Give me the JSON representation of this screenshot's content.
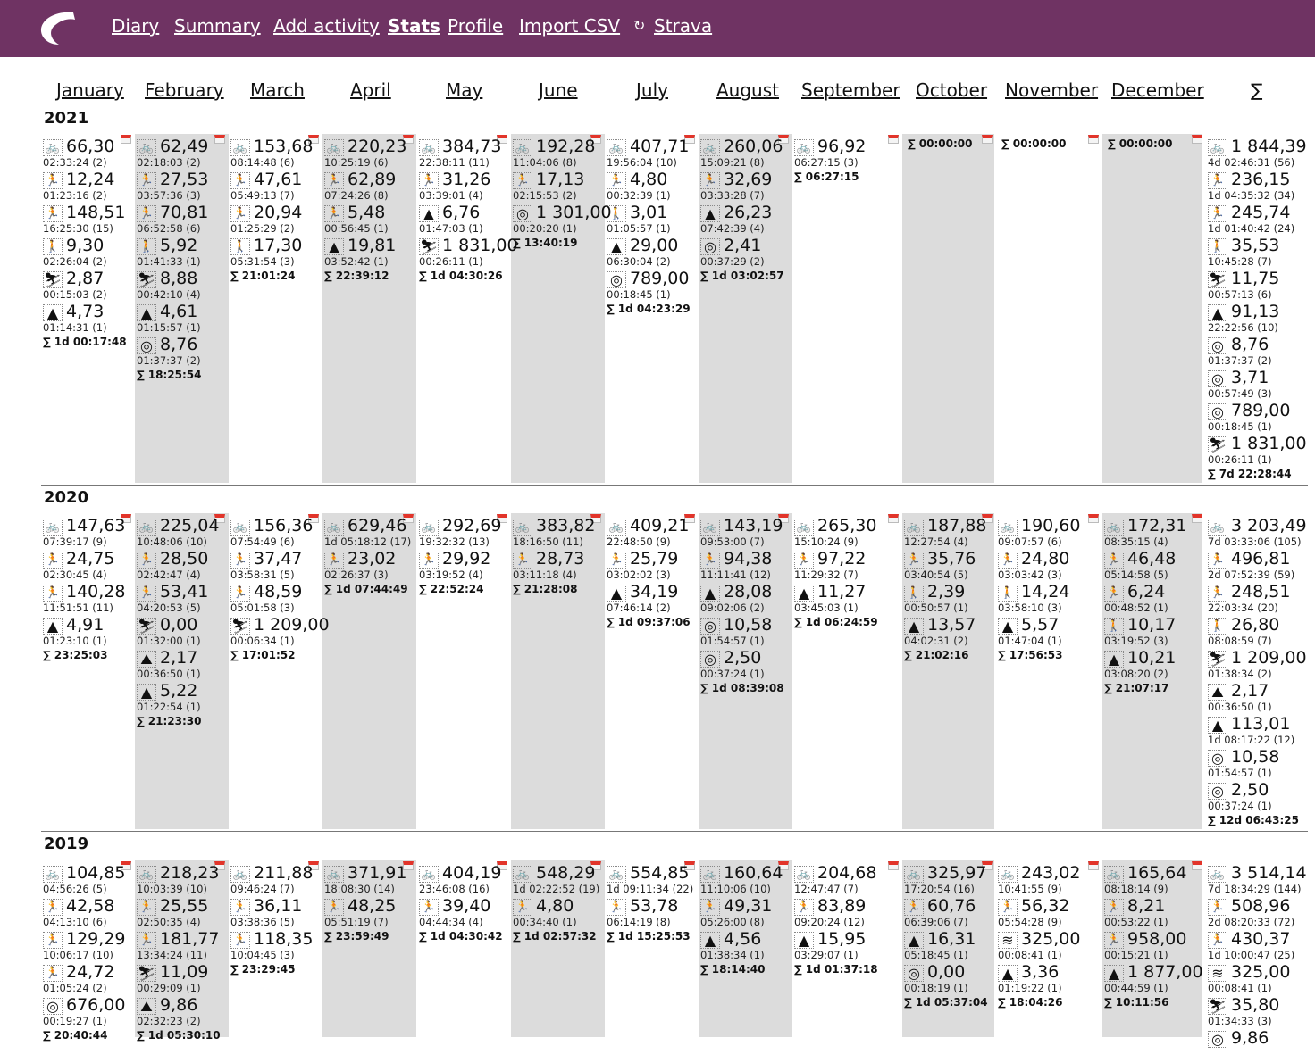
{
  "nav": {
    "items": [
      "Diary",
      "Summary",
      "Add activity",
      "Stats",
      "Profile",
      "Import CSV",
      "Strava"
    ],
    "active": "Stats"
  },
  "months": [
    "January",
    "February",
    "March",
    "April",
    "May",
    "June",
    "July",
    "August",
    "September",
    "October",
    "November",
    "December"
  ],
  "sigma": "∑",
  "icons": {
    "bike": "bicycle-icon",
    "run": "running-icon",
    "trail": "trail-running-icon",
    "walk": "walking-icon",
    "ski": "skiing-icon",
    "hike": "mountain-icon",
    "other": "workout-icon",
    "swim": "swimming-icon",
    "climb": "climbing-icon",
    "sync": "sync-icon"
  },
  "years": [
    {
      "year": "2021",
      "cols": [
        [
          [
            "bike",
            "66,30",
            "02:33:24 (2)"
          ],
          [
            "run",
            "12,24",
            "01:23:16 (2)"
          ],
          [
            "trail",
            "148,51",
            "16:25:30 (15)"
          ],
          [
            "walk",
            "9,30",
            "02:26:04 (2)"
          ],
          [
            "ski",
            "2,87",
            "00:15:03 (2)"
          ],
          [
            "hike",
            "4,73",
            "01:14:31 (1)"
          ],
          "∑ 1d 00:17:48"
        ],
        [
          [
            "bike",
            "62,49",
            "02:18:03 (2)"
          ],
          [
            "run",
            "27,53",
            "03:57:36 (3)"
          ],
          [
            "trail",
            "70,81",
            "06:52:58 (6)"
          ],
          [
            "walk",
            "5,92",
            "01:41:33 (1)"
          ],
          [
            "ski",
            "8,88",
            "00:42:10 (4)"
          ],
          [
            "hike",
            "4,61",
            "01:15:57 (1)"
          ],
          [
            "other",
            "8,76",
            "01:37:37 (2)"
          ],
          "∑ 18:25:54"
        ],
        [
          [
            "bike",
            "153,68",
            "08:14:48 (6)"
          ],
          [
            "run",
            "47,61",
            "05:49:13 (7)"
          ],
          [
            "trail",
            "20,94",
            "01:25:29 (2)"
          ],
          [
            "walk",
            "17,30",
            "05:31:54 (3)"
          ],
          "∑ 21:01:24"
        ],
        [
          [
            "bike",
            "220,23",
            "10:25:19 (6)"
          ],
          [
            "run",
            "62,89",
            "07:24:26 (8)"
          ],
          [
            "trail",
            "5,48",
            "00:56:45 (1)"
          ],
          [
            "hike",
            "19,81",
            "03:52:42 (1)"
          ],
          "∑ 22:39:12"
        ],
        [
          [
            "bike",
            "384,73",
            "22:38:11 (11)"
          ],
          [
            "run",
            "31,26",
            "03:39:01 (4)"
          ],
          [
            "hike",
            "6,76",
            "01:47:03 (1)"
          ],
          [
            "ski",
            "1 831,00",
            "00:26:11 (1)"
          ],
          "∑ 1d 04:30:26"
        ],
        [
          [
            "bike",
            "192,28",
            "11:04:06 (8)"
          ],
          [
            "run",
            "17,13",
            "02:15:53 (2)"
          ],
          [
            "other",
            "1 301,00",
            "00:20:20 (1)"
          ],
          "∑ 13:40:19"
        ],
        [
          [
            "bike",
            "407,71",
            "19:56:04 (10)"
          ],
          [
            "run",
            "4,80",
            "00:32:39 (1)"
          ],
          [
            "walk",
            "3,01",
            "01:05:57 (1)"
          ],
          [
            "hike",
            "29,00",
            "06:30:04 (2)"
          ],
          [
            "other",
            "789,00",
            "00:18:45 (1)"
          ],
          "∑ 1d 04:23:29"
        ],
        [
          [
            "bike",
            "260,06",
            "15:09:21 (8)"
          ],
          [
            "run",
            "32,69",
            "03:33:28 (7)"
          ],
          [
            "hike",
            "26,23",
            "07:42:39 (4)"
          ],
          [
            "other",
            "2,41",
            "00:37:29 (2)"
          ],
          "∑ 1d 03:02:57"
        ],
        [
          [
            "bike",
            "96,92",
            "06:27:15 (3)"
          ],
          "∑ 06:27:15"
        ],
        [
          "∑ 00:00:00"
        ],
        [
          "∑ 00:00:00"
        ],
        [
          "∑ 00:00:00"
        ],
        [
          [
            "bike",
            "1 844,39",
            "4d 02:46:31 (56)"
          ],
          [
            "run",
            "236,15",
            "1d 04:35:32 (34)"
          ],
          [
            "trail",
            "245,74",
            "1d 01:40:42 (24)"
          ],
          [
            "walk",
            "35,53",
            "10:45:28 (7)"
          ],
          [
            "ski",
            "11,75",
            "00:57:13 (6)"
          ],
          [
            "hike",
            "91,13",
            "22:22:56 (10)"
          ],
          [
            "other",
            "8,76",
            "01:37:37 (2)"
          ],
          [
            "other",
            "3,71",
            "00:57:49 (3)"
          ],
          [
            "other",
            "789,00",
            "00:18:45 (1)"
          ],
          [
            "ski",
            "1 831,00",
            "00:26:11 (1)"
          ],
          "∑ 7d 22:28:44"
        ]
      ]
    },
    {
      "year": "2020",
      "cols": [
        [
          [
            "bike",
            "147,63",
            "07:39:17 (9)"
          ],
          [
            "run",
            "24,75",
            "02:30:45 (4)"
          ],
          [
            "trail",
            "140,28",
            "11:51:51 (11)"
          ],
          [
            "hike",
            "4,91",
            "01:23:10 (1)"
          ],
          "∑ 23:25:03"
        ],
        [
          [
            "bike",
            "225,04",
            "10:48:06 (10)"
          ],
          [
            "run",
            "28,50",
            "02:42:47 (4)"
          ],
          [
            "trail",
            "53,41",
            "04:20:53 (5)"
          ],
          [
            "ski",
            "0,00",
            "01:32:00 (1)"
          ],
          [
            "climb",
            "2,17",
            "00:36:50 (1)"
          ],
          [
            "hike",
            "5,22",
            "01:22:54 (1)"
          ],
          "∑ 21:23:30"
        ],
        [
          [
            "bike",
            "156,36",
            "07:54:49 (6)"
          ],
          [
            "run",
            "37,47",
            "03:58:31 (5)"
          ],
          [
            "trail",
            "48,59",
            "05:01:58 (3)"
          ],
          [
            "ski",
            "1 209,00",
            "00:06:34 (1)"
          ],
          "∑ 17:01:52"
        ],
        [
          [
            "bike",
            "629,46",
            "1d 05:18:12 (17)"
          ],
          [
            "run",
            "23,02",
            "02:26:37 (3)"
          ],
          "∑ 1d 07:44:49"
        ],
        [
          [
            "bike",
            "292,69",
            "19:32:32 (13)"
          ],
          [
            "run",
            "29,92",
            "03:19:52 (4)"
          ],
          "∑ 22:52:24"
        ],
        [
          [
            "bike",
            "383,82",
            "18:16:50 (11)"
          ],
          [
            "run",
            "28,73",
            "03:11:18 (4)"
          ],
          "∑ 21:28:08"
        ],
        [
          [
            "bike",
            "409,21",
            "22:48:50 (9)"
          ],
          [
            "run",
            "25,79",
            "03:02:02 (3)"
          ],
          [
            "hike",
            "34,19",
            "07:46:14 (2)"
          ],
          "∑ 1d 09:37:06"
        ],
        [
          [
            "bike",
            "143,19",
            "09:53:00 (7)"
          ],
          [
            "run",
            "94,38",
            "11:11:41 (12)"
          ],
          [
            "hike",
            "28,08",
            "09:02:06 (2)"
          ],
          [
            "other",
            "10,58",
            "01:54:57 (1)"
          ],
          [
            "other",
            "2,50",
            "00:37:24 (1)"
          ],
          "∑ 1d 08:39:08"
        ],
        [
          [
            "bike",
            "265,30",
            "15:10:24 (9)"
          ],
          [
            "run",
            "97,22",
            "11:29:32 (7)"
          ],
          [
            "hike",
            "11,27",
            "03:45:03 (1)"
          ],
          "∑ 1d 06:24:59"
        ],
        [
          [
            "bike",
            "187,88",
            "12:27:54 (4)"
          ],
          [
            "run",
            "35,76",
            "03:40:54 (5)"
          ],
          [
            "walk",
            "2,39",
            "00:50:57 (1)"
          ],
          [
            "hike",
            "13,57",
            "04:02:31 (2)"
          ],
          "∑ 21:02:16"
        ],
        [
          [
            "bike",
            "190,60",
            "09:07:57 (6)"
          ],
          [
            "run",
            "24,80",
            "03:03:42 (3)"
          ],
          [
            "walk",
            "14,24",
            "03:58:10 (3)"
          ],
          [
            "hike",
            "5,57",
            "01:47:04 (1)"
          ],
          "∑ 17:56:53"
        ],
        [
          [
            "bike",
            "172,31",
            "08:35:15 (4)"
          ],
          [
            "run",
            "46,48",
            "05:14:58 (5)"
          ],
          [
            "trail",
            "6,24",
            "00:48:52 (1)"
          ],
          [
            "walk",
            "10,17",
            "03:19:52 (3)"
          ],
          [
            "hike",
            "10,21",
            "03:08:20 (2)"
          ],
          "∑ 21:07:17"
        ],
        [
          [
            "bike",
            "3 203,49",
            "7d 03:33:06 (105)"
          ],
          [
            "run",
            "496,81",
            "2d 07:52:39 (59)"
          ],
          [
            "trail",
            "248,51",
            "22:03:34 (20)"
          ],
          [
            "walk",
            "26,80",
            "08:08:59 (7)"
          ],
          [
            "ski",
            "1 209,00",
            "01:38:34 (2)"
          ],
          [
            "climb",
            "2,17",
            "00:36:50 (1)"
          ],
          [
            "hike",
            "113,01",
            "1d 08:17:22 (12)"
          ],
          [
            "other",
            "10,58",
            "01:54:57 (1)"
          ],
          [
            "other",
            "2,50",
            "00:37:24 (1)"
          ],
          "∑ 12d 06:43:25"
        ]
      ]
    },
    {
      "year": "2019",
      "cols": [
        [
          [
            "bike",
            "104,85",
            "04:56:26 (5)"
          ],
          [
            "run",
            "42,58",
            "04:13:10 (6)"
          ],
          [
            "trail",
            "129,29",
            "10:06:17 (10)"
          ],
          [
            "run",
            "24,72",
            "01:05:24 (2)"
          ],
          [
            "other",
            "676,00",
            "00:19:27 (1)"
          ],
          "∑ 20:40:44"
        ],
        [
          [
            "bike",
            "218,23",
            "10:03:39 (10)"
          ],
          [
            "run",
            "25,55",
            "02:50:35 (4)"
          ],
          [
            "trail",
            "181,77",
            "13:34:24 (11)"
          ],
          [
            "ski",
            "11,09",
            "00:29:09 (1)"
          ],
          [
            "climb",
            "9,86",
            "02:32:23 (2)"
          ],
          "∑ 1d 05:30:10"
        ],
        [
          [
            "bike",
            "211,88",
            "09:46:24 (7)"
          ],
          [
            "run",
            "36,11",
            "03:38:36 (5)"
          ],
          [
            "trail",
            "118,35",
            "10:04:45 (3)"
          ],
          "∑ 23:29:45"
        ],
        [
          [
            "bike",
            "371,91",
            "18:08:30 (14)"
          ],
          [
            "run",
            "48,25",
            "05:51:19 (7)"
          ],
          "∑ 23:59:49"
        ],
        [
          [
            "bike",
            "404,19",
            "23:46:08 (16)"
          ],
          [
            "run",
            "39,40",
            "04:44:34 (4)"
          ],
          "∑ 1d 04:30:42"
        ],
        [
          [
            "bike",
            "548,29",
            "1d 02:22:52 (19)"
          ],
          [
            "run",
            "4,80",
            "00:34:40 (1)"
          ],
          "∑ 1d 02:57:32"
        ],
        [
          [
            "bike",
            "554,85",
            "1d 09:11:34 (22)"
          ],
          [
            "run",
            "53,78",
            "06:14:19 (8)"
          ],
          "∑ 1d 15:25:53"
        ],
        [
          [
            "bike",
            "160,64",
            "11:10:06 (10)"
          ],
          [
            "run",
            "49,31",
            "05:26:00 (8)"
          ],
          [
            "hike",
            "4,56",
            "01:38:34 (1)"
          ],
          "∑ 18:14:40"
        ],
        [
          [
            "bike",
            "204,68",
            "12:47:47 (7)"
          ],
          [
            "run",
            "83,89",
            "09:20:24 (12)"
          ],
          [
            "hike",
            "15,95",
            "03:29:07 (1)"
          ],
          "∑ 1d 01:37:18"
        ],
        [
          [
            "bike",
            "325,97",
            "17:20:54 (16)"
          ],
          [
            "run",
            "60,76",
            "06:39:06 (7)"
          ],
          [
            "hike",
            "16,31",
            "05:18:45 (1)"
          ],
          [
            "other",
            "0,00",
            "00:18:19 (1)"
          ],
          "∑ 1d 05:37:04"
        ],
        [
          [
            "bike",
            "243,02",
            "10:41:55 (9)"
          ],
          [
            "run",
            "56,32",
            "05:54:28 (9)"
          ],
          [
            "swim",
            "325,00",
            "00:08:41 (1)"
          ],
          [
            "hike",
            "3,36",
            "01:19:22 (1)"
          ],
          "∑ 18:04:26"
        ],
        [
          [
            "bike",
            "165,64",
            "08:18:14 (9)"
          ],
          [
            "run",
            "8,21",
            "00:53:22 (1)"
          ],
          [
            "trail",
            "958,00",
            "00:15:21 (1)"
          ],
          [
            "hike",
            "1 877,00",
            "00:44:59 (1)"
          ],
          "∑ 10:11:56"
        ],
        [
          [
            "bike",
            "3 514,14",
            "7d 18:34:29 (144)"
          ],
          [
            "run",
            "508,96",
            "2d 08:20:33 (72)"
          ],
          [
            "trail",
            "430,37",
            "1d 10:00:47 (25)"
          ],
          [
            "swim",
            "325,00",
            "00:08:41 (1)"
          ],
          [
            "ski",
            "35,80",
            "01:34:33 (3)"
          ],
          [
            "other",
            "9,86",
            ""
          ]
        ]
      ]
    }
  ]
}
